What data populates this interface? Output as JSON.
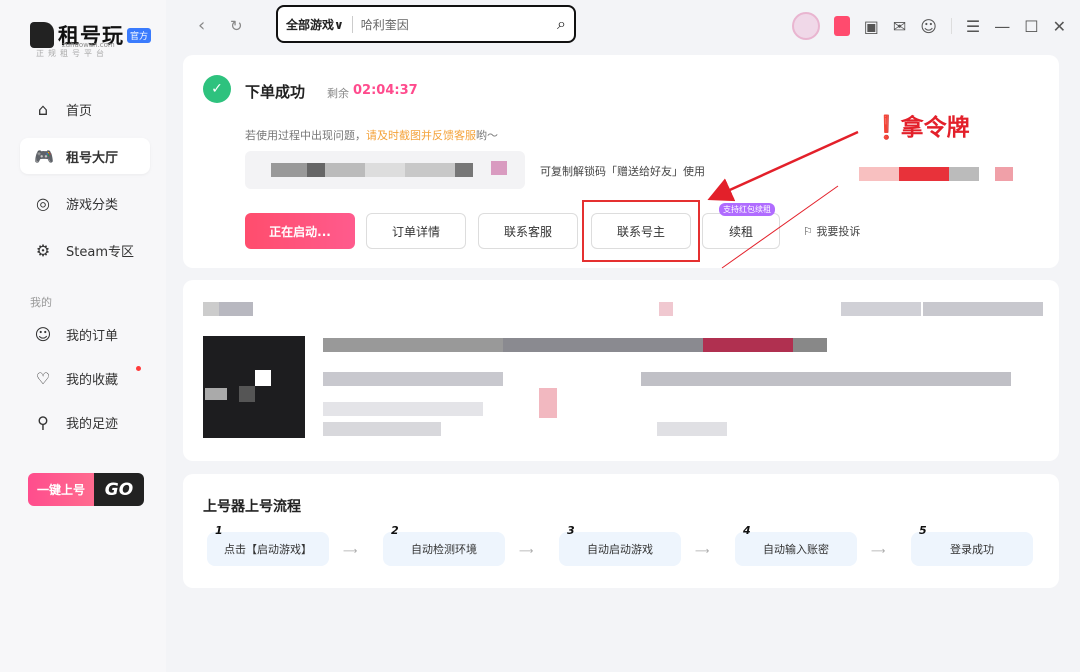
{
  "brand": {
    "name": "租号玩",
    "badge": "官方",
    "url": "zuhaowan.com",
    "tagline": "正规租号平台"
  },
  "sidebar": {
    "items": [
      {
        "label": "首页",
        "icon": "home-icon",
        "glyph": "⌂"
      },
      {
        "label": "租号大厅",
        "icon": "gamepad-icon",
        "glyph": "🎮"
      },
      {
        "label": "游戏分类",
        "icon": "category-icon",
        "glyph": "◎"
      },
      {
        "label": "Steam专区",
        "icon": "steam-icon",
        "glyph": "⚙"
      }
    ],
    "section_label": "我的",
    "my_items": [
      {
        "label": "我的订单",
        "icon": "order-icon",
        "glyph": "☺"
      },
      {
        "label": "我的收藏",
        "icon": "favorite-icon",
        "glyph": "♡"
      },
      {
        "label": "我的足迹",
        "icon": "footprint-icon",
        "glyph": "⚲"
      }
    ],
    "go_button": {
      "left": "一键上号",
      "right": "GO"
    }
  },
  "topbar": {
    "search_category": "全部游戏∨",
    "search_value": "哈利奎因",
    "search_icon": "search-icon"
  },
  "order": {
    "status_title": "下单成功",
    "remain_label": "剩余",
    "timer": "02:04:37",
    "hint_prefix": "若使用过程中出现问题，",
    "hint_highlight": "请及时截图并反馈客服",
    "hint_suffix": "哟～",
    "copy_tip": "可复制解锁码「赠送给好友」使用",
    "buttons": {
      "launching": "正在启动...",
      "order_detail": "订单详情",
      "contact_service": "联系客服",
      "contact_owner": "联系号主",
      "renew": "续租",
      "complain": "我要投诉"
    },
    "renew_tag": "支持红包续租"
  },
  "annotation": {
    "text": "❗拿令牌",
    "color": "#e3202a"
  },
  "flow": {
    "title": "上号器上号流程",
    "steps": [
      {
        "num": "1",
        "label": "点击【启动游戏】"
      },
      {
        "num": "2",
        "label": "自动检测环境"
      },
      {
        "num": "3",
        "label": "自动启动游戏"
      },
      {
        "num": "4",
        "label": "自动输入账密"
      },
      {
        "num": "5",
        "label": "登录成功"
      }
    ]
  },
  "colors": {
    "accent": "#ff4b8d",
    "success": "#2ec27e",
    "annotation_red": "#e3202a"
  }
}
